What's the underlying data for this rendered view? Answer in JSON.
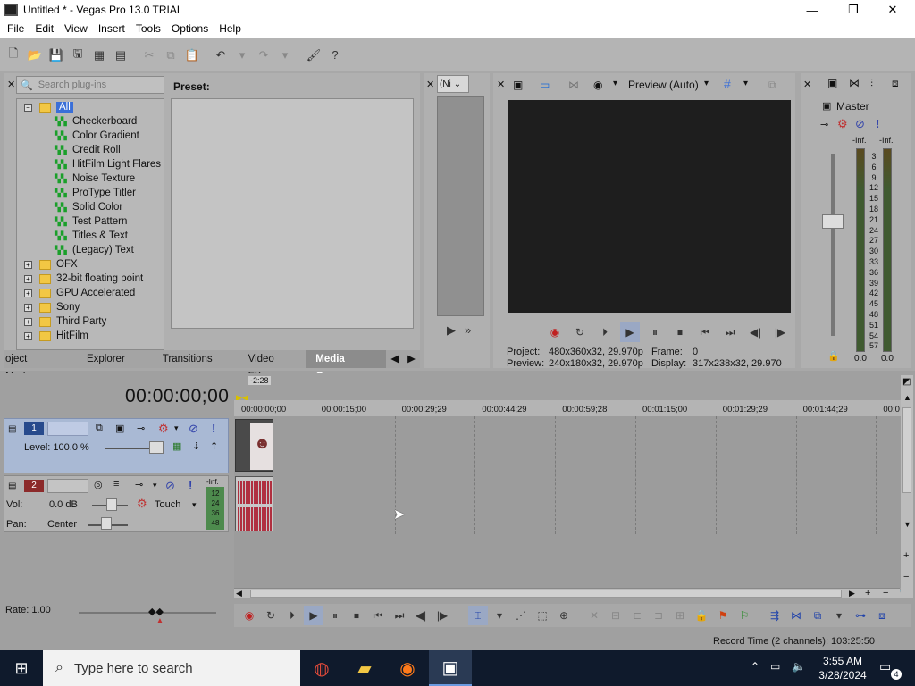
{
  "window": {
    "title": "Untitled * - Vegas Pro 13.0 TRIAL",
    "minimize": "—",
    "maximize": "❐",
    "close": "✕"
  },
  "menu": [
    "File",
    "Edit",
    "View",
    "Insert",
    "Tools",
    "Options",
    "Help"
  ],
  "plugins": {
    "search_placeholder": "Search plug-ins",
    "preset_label": "Preset:",
    "tree_root": "All",
    "children": [
      "Checkerboard",
      "Color Gradient",
      "Credit Roll",
      "HitFilm Light Flares",
      "Noise Texture",
      "ProType Titler",
      "Solid Color",
      "Test Pattern",
      "Titles & Text",
      "(Legacy) Text"
    ],
    "groups": [
      "OFX",
      "32-bit floating point",
      "GPU Accelerated",
      "Sony",
      "Third Party",
      "HitFilm"
    ]
  },
  "tabs": [
    "oject Media",
    "Explorer",
    "Transitions",
    "Video FX",
    "Media Genera"
  ],
  "trimmer": {
    "select": "(Ni"
  },
  "preview": {
    "mode": "Preview (Auto)",
    "project_label": "Project:",
    "project_value": "480x360x32, 29.970p",
    "preview_label": "Preview:",
    "preview_value": "240x180x32, 29.970p",
    "frame_label": "Frame:",
    "frame_value": "0",
    "display_label": "Display:",
    "display_value": "317x238x32, 29.970"
  },
  "master": {
    "label": "Master",
    "inf_left": "-Inf.",
    "inf_right": "-Inf.",
    "scale": [
      "3",
      "6",
      "9",
      "12",
      "15",
      "18",
      "21",
      "24",
      "27",
      "30",
      "33",
      "36",
      "39",
      "42",
      "45",
      "48",
      "51",
      "54",
      "57"
    ],
    "bottom_left": "0.0",
    "bottom_right": "0.0"
  },
  "timeline": {
    "timecode": "00:00:00;00",
    "marker": "-2:28",
    "ruler": [
      "00:00:00;00",
      "00:00:15;00",
      "00:00:29;29",
      "00:00:44;29",
      "00:00:59;28",
      "00:01:15;00",
      "00:01:29;29",
      "00:01:44;29",
      "00:0"
    ],
    "track1": {
      "num": "1",
      "level_label": "Level: 100.0 %"
    },
    "track2": {
      "num": "2",
      "vol_label": "Vol:",
      "vol_value": "0.0 dB",
      "pan_label": "Pan:",
      "pan_value": "Center",
      "touch": "Touch",
      "meter_inf": "-Inf.",
      "meter_scale": [
        "12",
        "24",
        "36",
        "48"
      ]
    }
  },
  "transport": {
    "rate": "Rate: 1.00",
    "record_time": "Record Time (2 channels): 103:25:50"
  },
  "taskbar": {
    "search_placeholder": "Type here to search",
    "time": "3:55 AM",
    "date": "3/28/2024",
    "notifications": "4"
  }
}
